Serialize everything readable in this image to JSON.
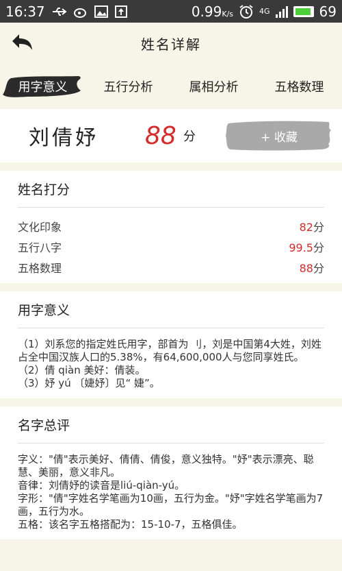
{
  "status": {
    "time": "16:37",
    "speed": "0.99",
    "speed_unit": "K/s",
    "network": "4G",
    "battery": "69"
  },
  "header": {
    "title": "姓名详解"
  },
  "tabs": [
    {
      "label": "用字意义"
    },
    {
      "label": "五行分析"
    },
    {
      "label": "属相分析"
    },
    {
      "label": "五格数理"
    }
  ],
  "result": {
    "name": "刘倩妤",
    "score": "88",
    "unit": "分",
    "fav_label": "+ 收藏"
  },
  "score_card": {
    "title": "姓名打分",
    "rows": [
      {
        "label": "文化印象",
        "value": "82",
        "unit": "分"
      },
      {
        "label": "五行八字",
        "value": "99.5",
        "unit": "分"
      },
      {
        "label": "五格数理",
        "value": "88",
        "unit": "分"
      }
    ]
  },
  "meaning_card": {
    "title": "用字意义",
    "lines": [
      "（1）刘系您的指定姓氏用字，部首为 刂，刘是中国第4大姓，刘姓占全中国汉族人口的5.38%，有64,600,000人与您同享姓氏。",
      "（2）倩 qiàn 美好：倩装。",
      "（3）妤 yú 〔婕妤〕见“ 婕”。"
    ]
  },
  "review_card": {
    "title": "名字总评",
    "lines": [
      "字义：\"倩\"表示美好、倩倩、倩俊，意义独特。\"妤\"表示漂亮、聪慧、美丽，意义非凡。",
      "音律：刘倩妤的读音是liú-qiàn-yú。",
      "字形：\"倩\"字姓名学笔画为10画，五行为金。\"妤\"字姓名学笔画为7画，五行为水。",
      "五格：该名字五格搭配为：15-10-7，五格俱佳。"
    ]
  },
  "colors": {
    "accent": "#d42b2b",
    "background": "#f7f5e8",
    "statusbar": "#3a3a3a",
    "brush_dark": "#2b2b2b",
    "brush_gray": "#a9a9a9"
  }
}
